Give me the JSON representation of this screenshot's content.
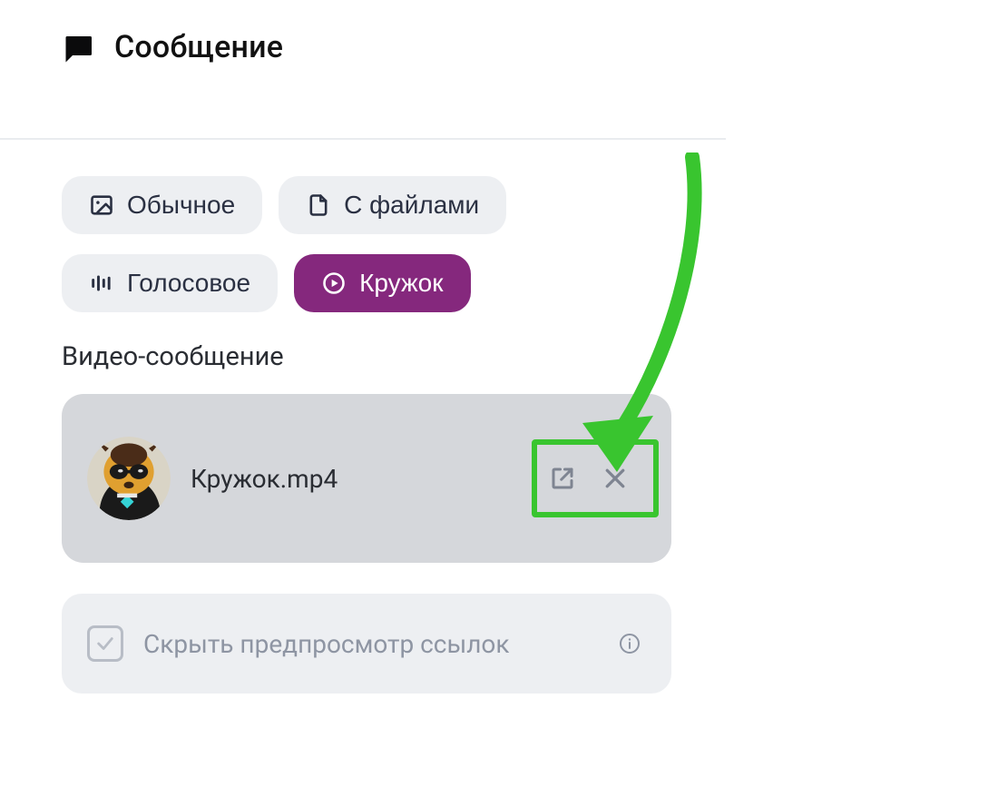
{
  "header": {
    "title": "Сообщение"
  },
  "messageTypes": {
    "normal": {
      "label": "Обычное"
    },
    "files": {
      "label": "С файлами"
    },
    "voice": {
      "label": "Голосовое"
    },
    "circle": {
      "label": "Кружок"
    }
  },
  "sectionLabel": "Видео-сообщение",
  "file": {
    "name": "Кружок.mp4"
  },
  "option": {
    "label": "Скрыть предпросмотр ссылок"
  },
  "colors": {
    "accent": "#85287d",
    "highlight": "#39c52f"
  }
}
